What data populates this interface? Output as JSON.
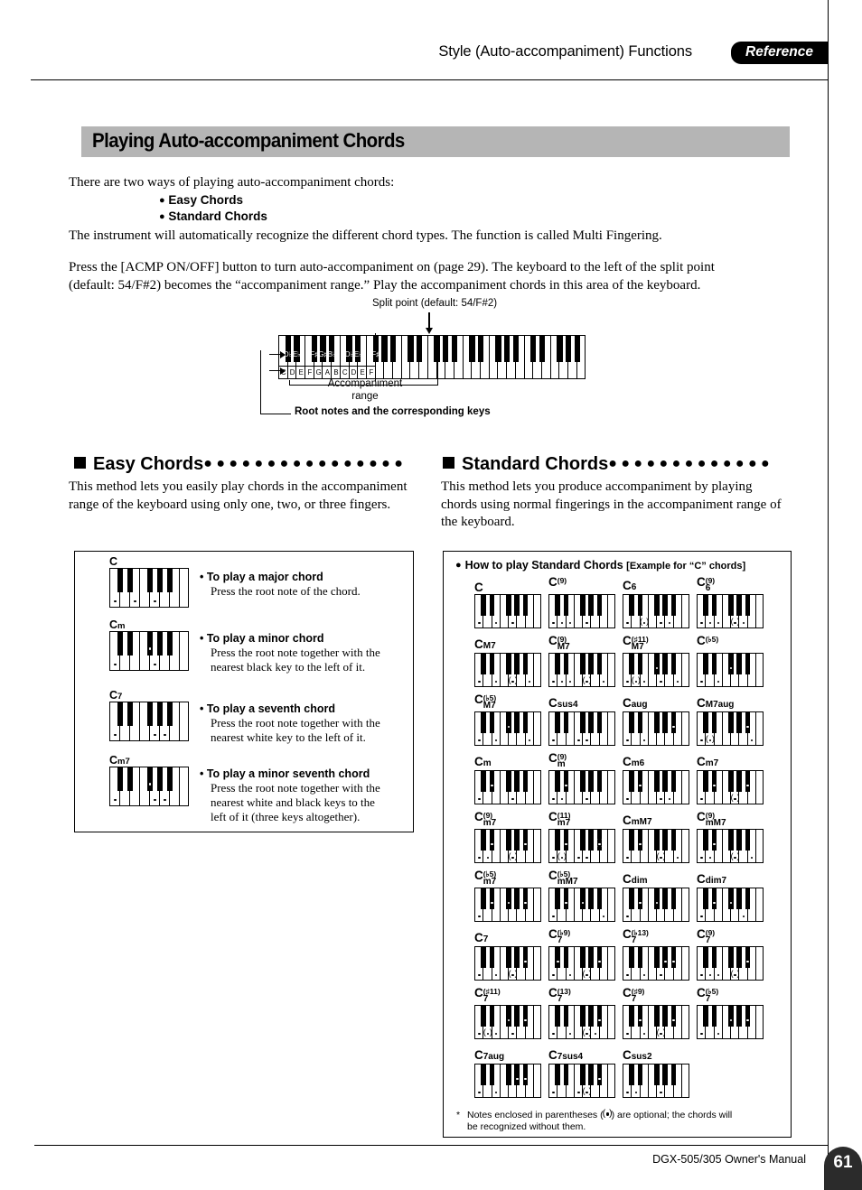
{
  "header": {
    "title": "Style (Auto-accompaniment) Functions",
    "badge": "Reference"
  },
  "page_title": "Playing Auto-accompaniment Chords",
  "intro": {
    "line1": "There are two ways of playing auto-accompaniment chords:",
    "bullet1": "Easy Chords",
    "bullet2": "Standard Chords",
    "line2": "The instrument will automatically recognize the different chord types. The function is called Multi Fingering.",
    "para2_a": "Press the [ACMP ON/OFF] button to turn auto-accompaniment on (page 29). The keyboard to the left of the split point",
    "para2_b": "(default: 54/F#2) becomes the “accompaniment range.” Play the accompaniment chords in this area of the keyboard."
  },
  "keyboard_diagram": {
    "split_label": "Split point (default: 54/F#2)",
    "accompaniment_label_line1": "Accompaniment",
    "accompaniment_label_line2": "range",
    "root_notes_label": "Root notes and the corresponding keys",
    "white_key_labels": [
      "C",
      "D",
      "E",
      "F",
      "G",
      "A",
      "B",
      "C",
      "D",
      "E",
      "F"
    ],
    "black_key_labels": [
      "D♭",
      "E♭",
      "F♯",
      "G♯",
      "B♭",
      "D♭",
      "E♭",
      "F♯"
    ]
  },
  "easy": {
    "heading": "Easy Chords",
    "dots": "●●●●●●●●●●●●●●●●",
    "body": "This method lets you easily play chords in the accompaniment range of the keyboard using only one, two, or three fingers.",
    "rows": [
      {
        "name_root": "C",
        "name_sub": "",
        "title": "To play a major chord",
        "lines": [
          "Press the root note of the chord."
        ]
      },
      {
        "name_root": "C",
        "name_sub": "m",
        "title": "To play a minor chord",
        "lines": [
          "Press the root note together with the",
          "nearest black key to the left of it."
        ]
      },
      {
        "name_root": "C",
        "name_sub": "7",
        "title": "To play a seventh chord",
        "lines": [
          "Press the root note together with the",
          "nearest white key to the left of it."
        ]
      },
      {
        "name_root": "C",
        "name_sub": "m7",
        "title": "To play a minor seventh chord",
        "lines": [
          "Press the root note together with the",
          "nearest white and black keys to the",
          "left of it (three keys altogether)."
        ]
      }
    ]
  },
  "standard": {
    "heading": "Standard Chords",
    "dots": "●●●●●●●●●●●●●",
    "body": "This method lets you produce accompaniment by playing chords using normal fingerings in the accompaniment range of the keyboard.",
    "box_heading": "How to play Standard Chords",
    "box_heading_suffix": "[Example for “C” chords]",
    "footnote_star": "*",
    "footnote_line1_a": "Notes enclosed in parentheses (",
    "footnote_line1_b": ") are optional; the chords will",
    "footnote_line2": "be recognized without them.",
    "chords": [
      {
        "root": "C",
        "quality": "",
        "sup": ""
      },
      {
        "root": "C",
        "quality": "",
        "sup": "(9)"
      },
      {
        "root": "C",
        "quality": "6",
        "sup": ""
      },
      {
        "root": "C",
        "quality": "6",
        "sup": "(9)"
      },
      {
        "root": "C",
        "quality": "M7",
        "sup": ""
      },
      {
        "root": "C",
        "quality": "M7",
        "sup": "(9)"
      },
      {
        "root": "C",
        "quality": "M7",
        "sup": "(♯11)"
      },
      {
        "root": "C",
        "quality": "",
        "sup": "(♭5)"
      },
      {
        "root": "C",
        "quality": "M7",
        "sup": "(♭5)"
      },
      {
        "root": "C",
        "quality": "sus4",
        "sup": ""
      },
      {
        "root": "C",
        "quality": "aug",
        "sup": ""
      },
      {
        "root": "C",
        "quality": "M7aug",
        "sup": ""
      },
      {
        "root": "C",
        "quality": "m",
        "sup": ""
      },
      {
        "root": "C",
        "quality": "m",
        "sup": "(9)"
      },
      {
        "root": "C",
        "quality": "m6",
        "sup": ""
      },
      {
        "root": "C",
        "quality": "m7",
        "sup": ""
      },
      {
        "root": "C",
        "quality": "m7",
        "sup": "(9)"
      },
      {
        "root": "C",
        "quality": "m7",
        "sup": "(11)"
      },
      {
        "root": "C",
        "quality": "mM7",
        "sup": ""
      },
      {
        "root": "C",
        "quality": "mM7",
        "sup": "(9)"
      },
      {
        "root": "C",
        "quality": "m7",
        "sup": "(♭5)"
      },
      {
        "root": "C",
        "quality": "mM7",
        "sup": "(♭5)"
      },
      {
        "root": "C",
        "quality": "dim",
        "sup": ""
      },
      {
        "root": "C",
        "quality": "dim7",
        "sup": ""
      },
      {
        "root": "C",
        "quality": "7",
        "sup": ""
      },
      {
        "root": "C",
        "quality": "7",
        "sup": "(♭9)"
      },
      {
        "root": "C",
        "quality": "7",
        "sup": "(♭13)"
      },
      {
        "root": "C",
        "quality": "7",
        "sup": "(9)"
      },
      {
        "root": "C",
        "quality": "7",
        "sup": "(♯11)"
      },
      {
        "root": "C",
        "quality": "7",
        "sup": "(13)"
      },
      {
        "root": "C",
        "quality": "7",
        "sup": "(♯9)"
      },
      {
        "root": "C",
        "quality": "7",
        "sup": "(♭5)"
      },
      {
        "root": "C",
        "quality": "7aug",
        "sup": ""
      },
      {
        "root": "C",
        "quality": "7sus4",
        "sup": ""
      },
      {
        "root": "C",
        "quality": "sus2",
        "sup": ""
      }
    ]
  },
  "footer": {
    "manual": "DGX-505/305  Owner's Manual",
    "page": "61"
  }
}
